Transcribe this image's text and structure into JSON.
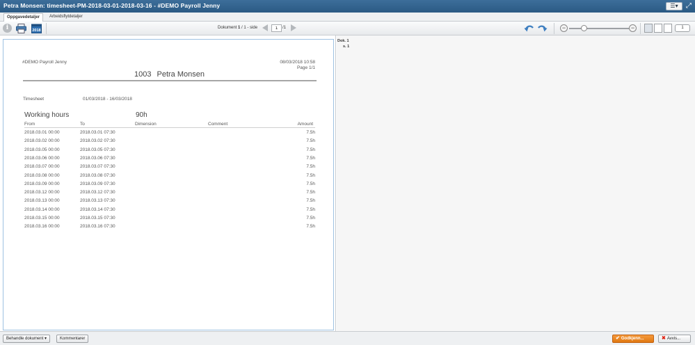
{
  "window": {
    "title": "Petra Monsen: timesheet-PM-2018-03-01-2018-03-16 - #DEMO Payroll Jenny"
  },
  "tabs": [
    {
      "label": "Oppgavedetaljer",
      "active": true
    },
    {
      "label": "Arbeidsflytdetaljer",
      "active": false
    }
  ],
  "toolbar": {
    "icons": [
      "info-icon",
      "print-icon",
      "calendar-icon",
      "rotate-left-icon",
      "rotate-right-icon",
      "zoom-out-icon",
      "zoom-in-icon"
    ],
    "pager_prefix": "Dokument",
    "pager_doc_current": "1",
    "pager_doc_sep": "/ 1 - side",
    "page_value": "1",
    "page_total": "/1",
    "zoom_out": "−",
    "zoom_in": "−",
    "zoom_level": 0.2,
    "view_count": "1"
  },
  "side": {
    "doc_label": "Dok. 1",
    "page_label": "s. 1"
  },
  "document": {
    "company": "#DEMO Payroll Jenny",
    "date": "08/03/2018 10:58",
    "page": "Page 1/1",
    "employee_id": "1003",
    "employee_name": "Petra Monsen",
    "timesheet_label": "Timesheet",
    "timesheet_range": "01/03/2018 - 16/03/2018",
    "section_title": "Working hours",
    "section_total": "90h",
    "columns": {
      "from": "From",
      "to": "To",
      "dimension": "Dimension",
      "comment": "Comment",
      "amount": "Amount"
    },
    "rows": [
      {
        "from": "2018.03.01 00:00",
        "to": "2018.03.01 07:30",
        "amount": "7.5h"
      },
      {
        "from": "2018.03.02 00:00",
        "to": "2018.03.02 07:30",
        "amount": "7.5h"
      },
      {
        "from": "2018.03.05 00:00",
        "to": "2018.03.05 07:30",
        "amount": "7.5h"
      },
      {
        "from": "2018.03.06 00:00",
        "to": "2018.03.06 07:30",
        "amount": "7.5h"
      },
      {
        "from": "2018.03.07 00:00",
        "to": "2018.03.07 07:30",
        "amount": "7.5h"
      },
      {
        "from": "2018.03.08 00:00",
        "to": "2018.03.08 07:30",
        "amount": "7.5h"
      },
      {
        "from": "2018.03.09 00:00",
        "to": "2018.03.09 07:30",
        "amount": "7.5h"
      },
      {
        "from": "2018.03.12 00:00",
        "to": "2018.03.12 07:30",
        "amount": "7.5h"
      },
      {
        "from": "2018.03.13 00:00",
        "to": "2018.03.13 07:30",
        "amount": "7.5h"
      },
      {
        "from": "2018.03.14 00:00",
        "to": "2018.03.14 07:30",
        "amount": "7.5h"
      },
      {
        "from": "2018.03.15 00:00",
        "to": "2018.03.15 07:30",
        "amount": "7.5h"
      },
      {
        "from": "2018.03.16 00:00",
        "to": "2018.03.16 07:30",
        "amount": "7.5h"
      }
    ]
  },
  "footer": {
    "process_label": "Behandle dokument ▾",
    "comments_label": "Kommentarer",
    "approve_label": "Godkjenn...",
    "reject_label": "Avvis..."
  },
  "colors": {
    "titlebar": "#2f5f8a",
    "approve": "#ea8420",
    "page_border": "#9ec1e2"
  }
}
